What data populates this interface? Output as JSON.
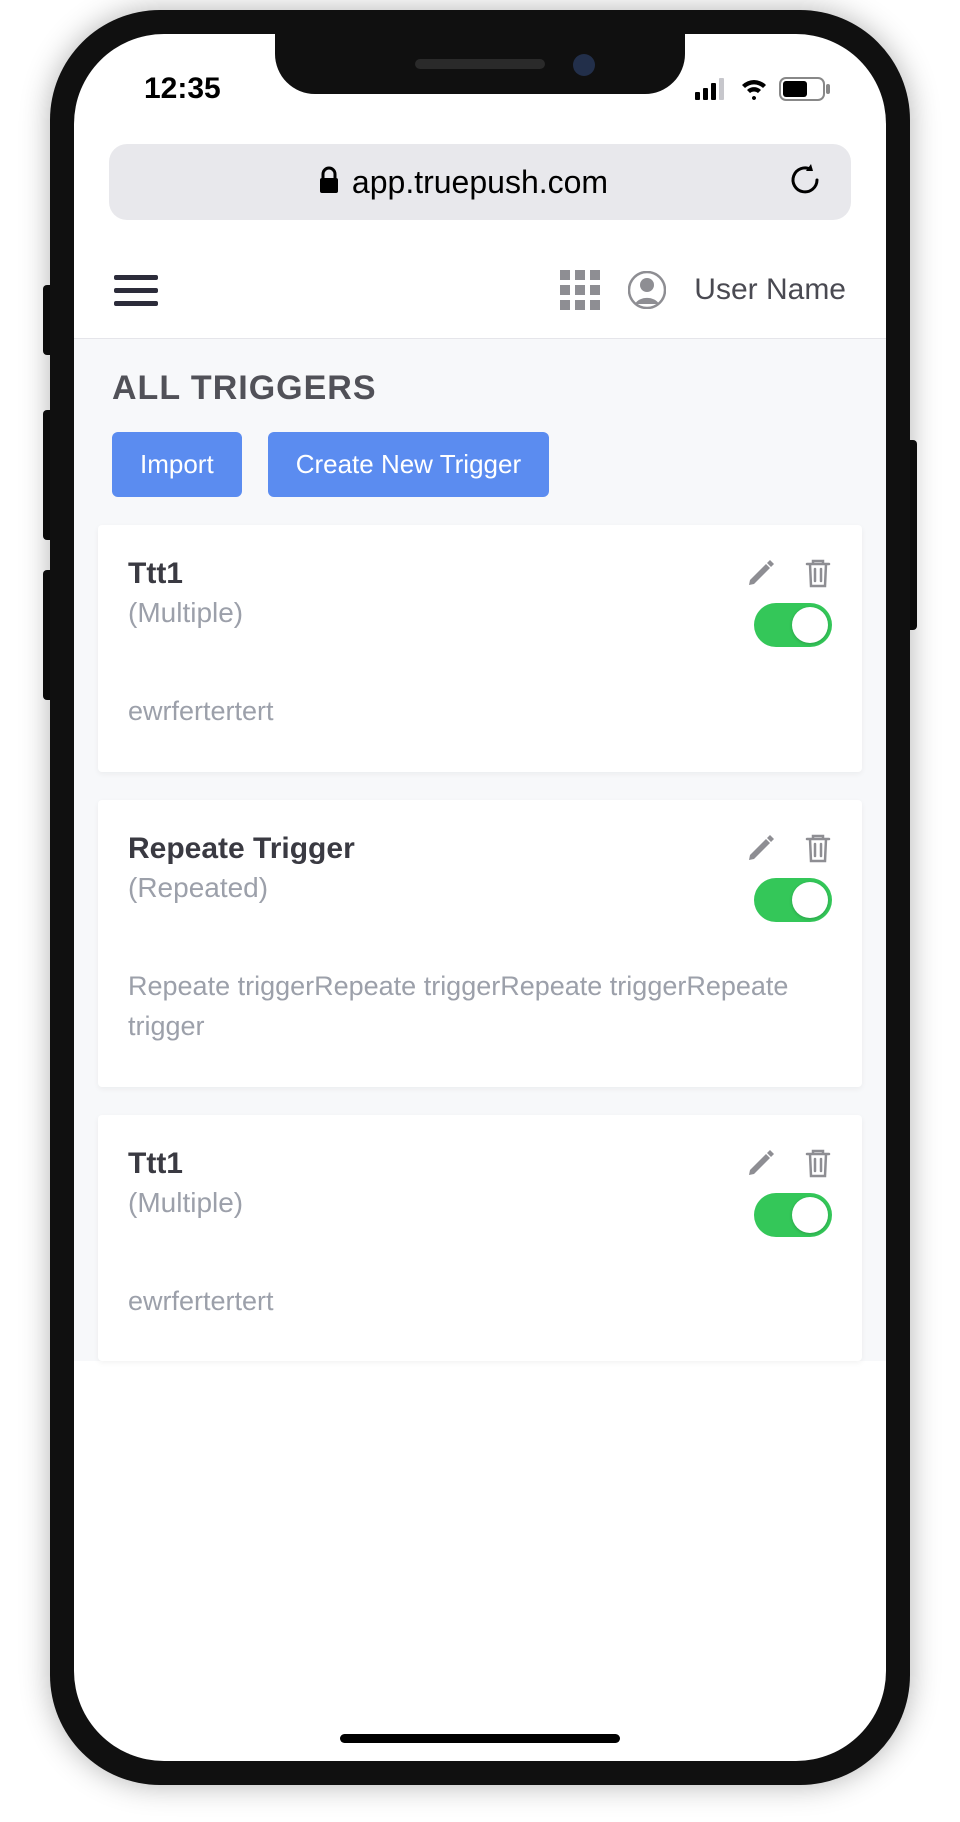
{
  "status": {
    "time": "12:35"
  },
  "browser": {
    "url": "app.truepush.com"
  },
  "header": {
    "username": "User Name"
  },
  "page": {
    "title": "ALL TRIGGERS",
    "buttons": {
      "import": "Import",
      "create": "Create New Trigger"
    }
  },
  "triggers": [
    {
      "title": "Ttt1",
      "subtitle": "(Multiple)",
      "description": "ewrfertertert",
      "enabled": true
    },
    {
      "title": "Repeate Trigger",
      "subtitle": "(Repeated)",
      "description": "Repeate triggerRepeate triggerRepeate triggerRepeate trigger",
      "enabled": true
    },
    {
      "title": "Ttt1",
      "subtitle": "(Multiple)",
      "description": "ewrfertertert",
      "enabled": true
    }
  ]
}
